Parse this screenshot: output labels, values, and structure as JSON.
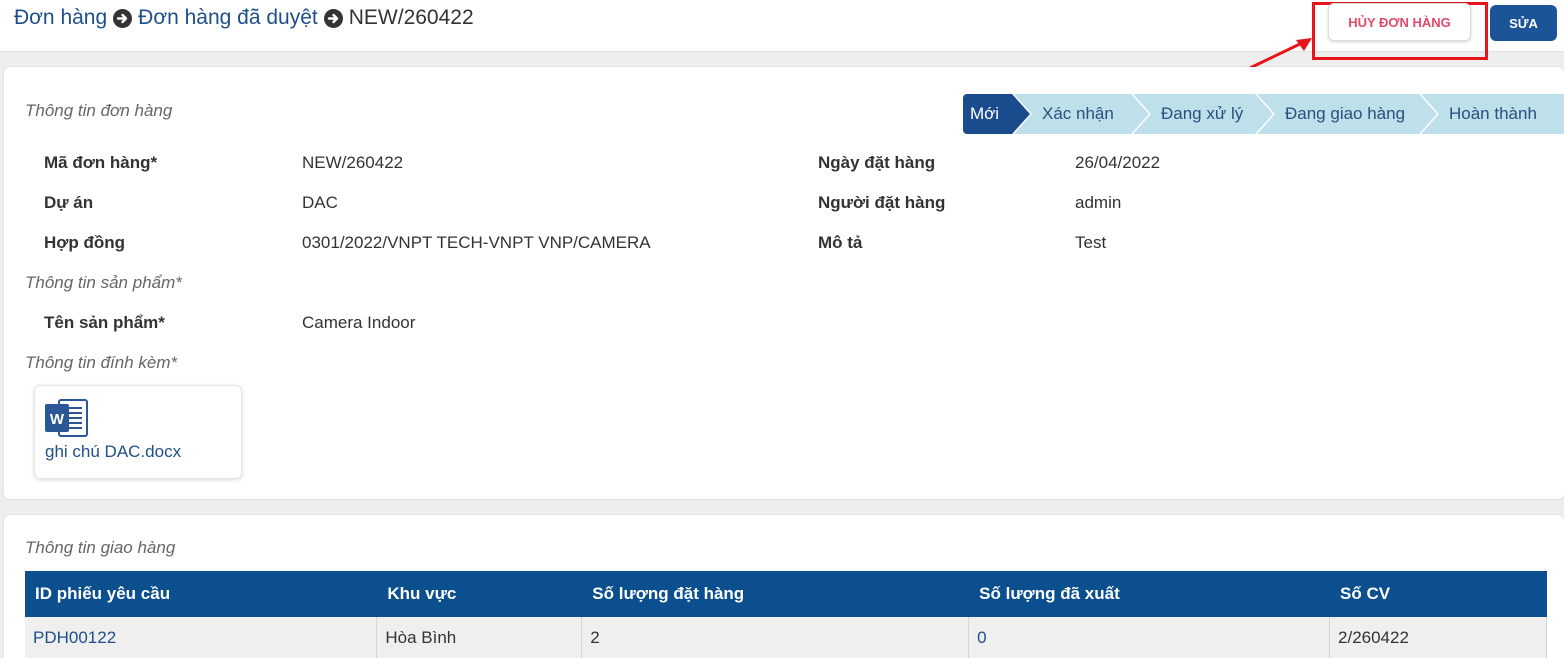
{
  "breadcrumb": {
    "items": [
      "Đơn hàng",
      "Đơn hàng đã duyệt"
    ],
    "current": "NEW/260422"
  },
  "toolbar": {
    "cancel_label": "HỦY ĐƠN HÀNG",
    "edit_label": "SỬA"
  },
  "colors": {
    "primary": "#1c5597",
    "step_inactive": "#bde0ea",
    "highlight": "#e8141b",
    "cancel_text": "#e34a6a"
  },
  "order_section": {
    "title": "Thông tin đơn hàng",
    "steps": [
      {
        "label": "Mới",
        "active": true
      },
      {
        "label": "Xác nhận",
        "active": false
      },
      {
        "label": "Đang xử lý",
        "active": false
      },
      {
        "label": "Đang giao hàng",
        "active": false
      },
      {
        "label": "Hoàn thành",
        "active": false
      }
    ],
    "fields_left": [
      {
        "label": "Mã đơn hàng*",
        "value": "NEW/260422"
      },
      {
        "label": "Dự án",
        "value": "DAC"
      },
      {
        "label": "Hợp đồng",
        "value": "0301/2022/VNPT TECH-VNPT VNP/CAMERA"
      }
    ],
    "fields_right": [
      {
        "label": "Ngày đặt hàng",
        "value": "26/04/2022"
      },
      {
        "label": "Người đặt hàng",
        "value": "admin"
      },
      {
        "label": "Mô tả",
        "value": "Test"
      }
    ]
  },
  "product_section": {
    "title": "Thông tin sản phẩm*",
    "label": "Tên sản phẩm*",
    "value": "Camera Indoor"
  },
  "attachment_section": {
    "title": "Thông tin đính kèm*",
    "file_name": "ghi chú DAC.docx",
    "icon": "word-document-icon"
  },
  "delivery_section": {
    "title": "Thông tin giao hàng",
    "columns": [
      "ID phiếu yêu cầu",
      "Khu vực",
      "Số lượng đặt hàng",
      "Số lượng đã xuất",
      "Số CV"
    ],
    "rows": [
      [
        "PDH00122",
        "Hòa Bình",
        "2",
        "0",
        "2/260422"
      ]
    ]
  }
}
